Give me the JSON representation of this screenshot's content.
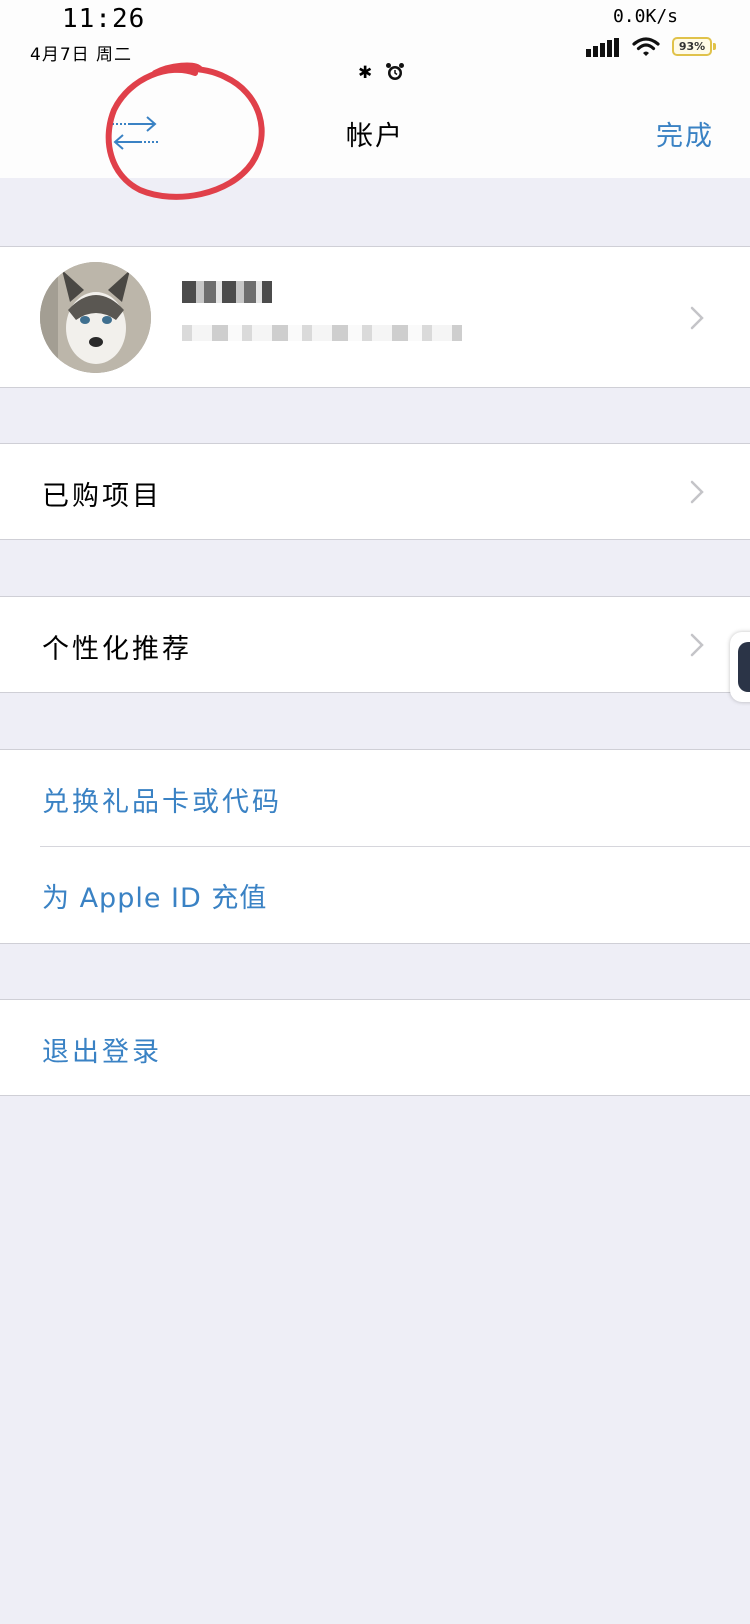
{
  "status_bar": {
    "time": "11:26",
    "date": "4月7日  周二",
    "network_speed": "0.0K/s",
    "battery_percent": "93%",
    "battery_level": 0.93,
    "battery_color": "#e0c24a",
    "icons": [
      "signal-icon",
      "wifi-icon",
      "bluetooth-icon",
      "alarm-icon"
    ]
  },
  "nav": {
    "title": "帐户",
    "done_label": "完成",
    "switch_icon": "switch-arrows-icon",
    "accent_color": "#3a82c4"
  },
  "annotation": {
    "color": "#e0404a",
    "shape": "hand-drawn circle around switch icon"
  },
  "profile": {
    "name_redacted": true,
    "email_redacted": true,
    "avatar": "husky-dog-photo"
  },
  "menu": {
    "purchased_label": "已购项目",
    "personalize_label": "个性化推荐",
    "redeem_label": "兑换礼品卡或代码",
    "topup_label": "为 Apple ID 充值",
    "logout_label": "退出登录"
  },
  "colors": {
    "background": "#eeeef6",
    "row": "#ffffff",
    "link": "#3a82c4",
    "chevron": "#c4c4c8"
  }
}
